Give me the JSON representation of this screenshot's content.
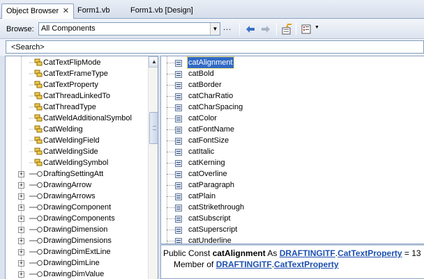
{
  "tabs": [
    {
      "label": "Object Browser",
      "close": "✕",
      "active": true
    },
    {
      "label": "Form1.vb",
      "active": false
    },
    {
      "label": "Form1.vb [Design]",
      "active": false
    }
  ],
  "toolbar": {
    "browse_label": "Browse:",
    "browse_value": "All Components",
    "ellipsis": "..."
  },
  "search": {
    "value": "<Search>"
  },
  "tree": {
    "items": [
      {
        "label": "CatTextFlipMode",
        "icon": "enum-icon",
        "expandable": false
      },
      {
        "label": "CatTextFrameType",
        "icon": "enum-icon",
        "expandable": false
      },
      {
        "label": "CatTextProperty",
        "icon": "enum-icon",
        "expandable": false,
        "selected": true
      },
      {
        "label": "CatThreadLinkedTo",
        "icon": "enum-icon",
        "expandable": false
      },
      {
        "label": "CatThreadType",
        "icon": "enum-icon",
        "expandable": false
      },
      {
        "label": "CatWeldAdditionalSymbol",
        "icon": "enum-icon",
        "expandable": false
      },
      {
        "label": "CatWelding",
        "icon": "enum-icon",
        "expandable": false
      },
      {
        "label": "CatWeldingField",
        "icon": "enum-icon",
        "expandable": false
      },
      {
        "label": "CatWeldingSide",
        "icon": "enum-icon",
        "expandable": false
      },
      {
        "label": "CatWeldingSymbol",
        "icon": "enum-icon",
        "expandable": false
      },
      {
        "label": "DraftingSettingAtt",
        "icon": "interface-icon",
        "expandable": true
      },
      {
        "label": "DrawingArrow",
        "icon": "interface-icon",
        "expandable": true
      },
      {
        "label": "DrawingArrows",
        "icon": "interface-icon",
        "expandable": true
      },
      {
        "label": "DrawingComponent",
        "icon": "interface-icon",
        "expandable": true
      },
      {
        "label": "DrawingComponents",
        "icon": "interface-icon",
        "expandable": true
      },
      {
        "label": "DrawingDimension",
        "icon": "interface-icon",
        "expandable": true
      },
      {
        "label": "DrawingDimensions",
        "icon": "interface-icon",
        "expandable": true
      },
      {
        "label": "DrawingDimExtLine",
        "icon": "interface-icon",
        "expandable": true
      },
      {
        "label": "DrawingDimLine",
        "icon": "interface-icon",
        "expandable": true
      },
      {
        "label": "DrawingDimValue",
        "icon": "interface-icon",
        "expandable": true
      }
    ],
    "expander_glyph": "+"
  },
  "members": {
    "items": [
      {
        "label": "catAlignment",
        "selected": true
      },
      {
        "label": "catBold"
      },
      {
        "label": "catBorder"
      },
      {
        "label": "catCharRatio"
      },
      {
        "label": "catCharSpacing"
      },
      {
        "label": "catColor"
      },
      {
        "label": "catFontName"
      },
      {
        "label": "catFontSize"
      },
      {
        "label": "catItalic"
      },
      {
        "label": "catKerning"
      },
      {
        "label": "catOverline"
      },
      {
        "label": "catParagraph"
      },
      {
        "label": "catPlain"
      },
      {
        "label": "catStrikethrough"
      },
      {
        "label": "catSubscript"
      },
      {
        "label": "catSuperscript"
      },
      {
        "label": "catUnderline"
      }
    ]
  },
  "description": {
    "prefix": "Public Const ",
    "name": "catAlignment",
    "as": " As ",
    "library": "DRAFTINGITF",
    "dot": ".",
    "type": "CatTextProperty",
    "value": " = 13",
    "member_of": "Member of ",
    "parent_library": "DRAFTINGITF",
    "parent_dot": ".",
    "parent_type": "CatTextProperty"
  },
  "colors": {
    "selection": "#316ac5",
    "link": "#1c4fb0",
    "border": "#8ea3c4",
    "enum_icon": "#d4a017",
    "interface_icon": "#5a7fb5"
  }
}
